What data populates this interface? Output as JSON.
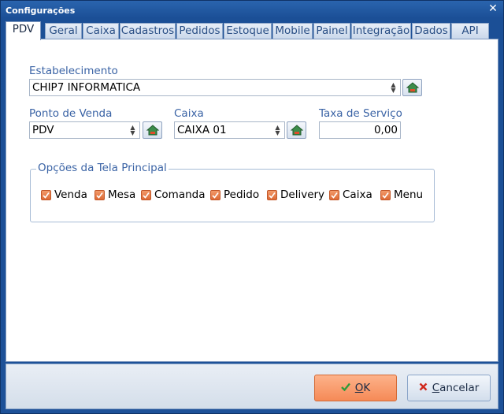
{
  "window": {
    "title": "Configurações",
    "close_glyph": "✕"
  },
  "tabs": [
    {
      "label": "PDV",
      "active": true
    },
    {
      "label": "Geral"
    },
    {
      "label": "Caixa"
    },
    {
      "label": "Cadastros"
    },
    {
      "label": "Pedidos"
    },
    {
      "label": "Estoque"
    },
    {
      "label": "Mobile"
    },
    {
      "label": "Painel"
    },
    {
      "label": "Integração"
    },
    {
      "label": "Dados"
    },
    {
      "label": "API"
    }
  ],
  "form": {
    "estabelecimento": {
      "label": "Estabelecimento",
      "value": "CHIP7 INFORMATICA"
    },
    "ponto_venda": {
      "label": "Ponto de Venda",
      "value": "PDV"
    },
    "caixa": {
      "label": "Caixa",
      "value": "CAIXA 01"
    },
    "taxa_servico": {
      "label": "Taxa de Serviço",
      "value": "0,00"
    },
    "lookup_icon": "house-lookup-icon"
  },
  "opcoes": {
    "title": "Opções da Tela Principal",
    "items": [
      {
        "label": "Venda",
        "checked": true
      },
      {
        "label": "Mesa",
        "checked": true
      },
      {
        "label": "Comanda",
        "checked": true
      },
      {
        "label": "Pedido",
        "checked": true
      },
      {
        "label": "Delivery",
        "checked": true
      },
      {
        "label": "Caixa",
        "checked": true
      },
      {
        "label": "Menu",
        "checked": true
      }
    ]
  },
  "buttons": {
    "ok": {
      "label_underlined": "O",
      "label_rest": "K",
      "icon": "check-icon"
    },
    "cancel": {
      "label_underlined": "C",
      "label_rest": "ancelar",
      "icon": "x-icon"
    }
  },
  "colors": {
    "accent": "#f58a57",
    "label_blue": "#3a63a5",
    "title_bar": "#1d5198"
  }
}
